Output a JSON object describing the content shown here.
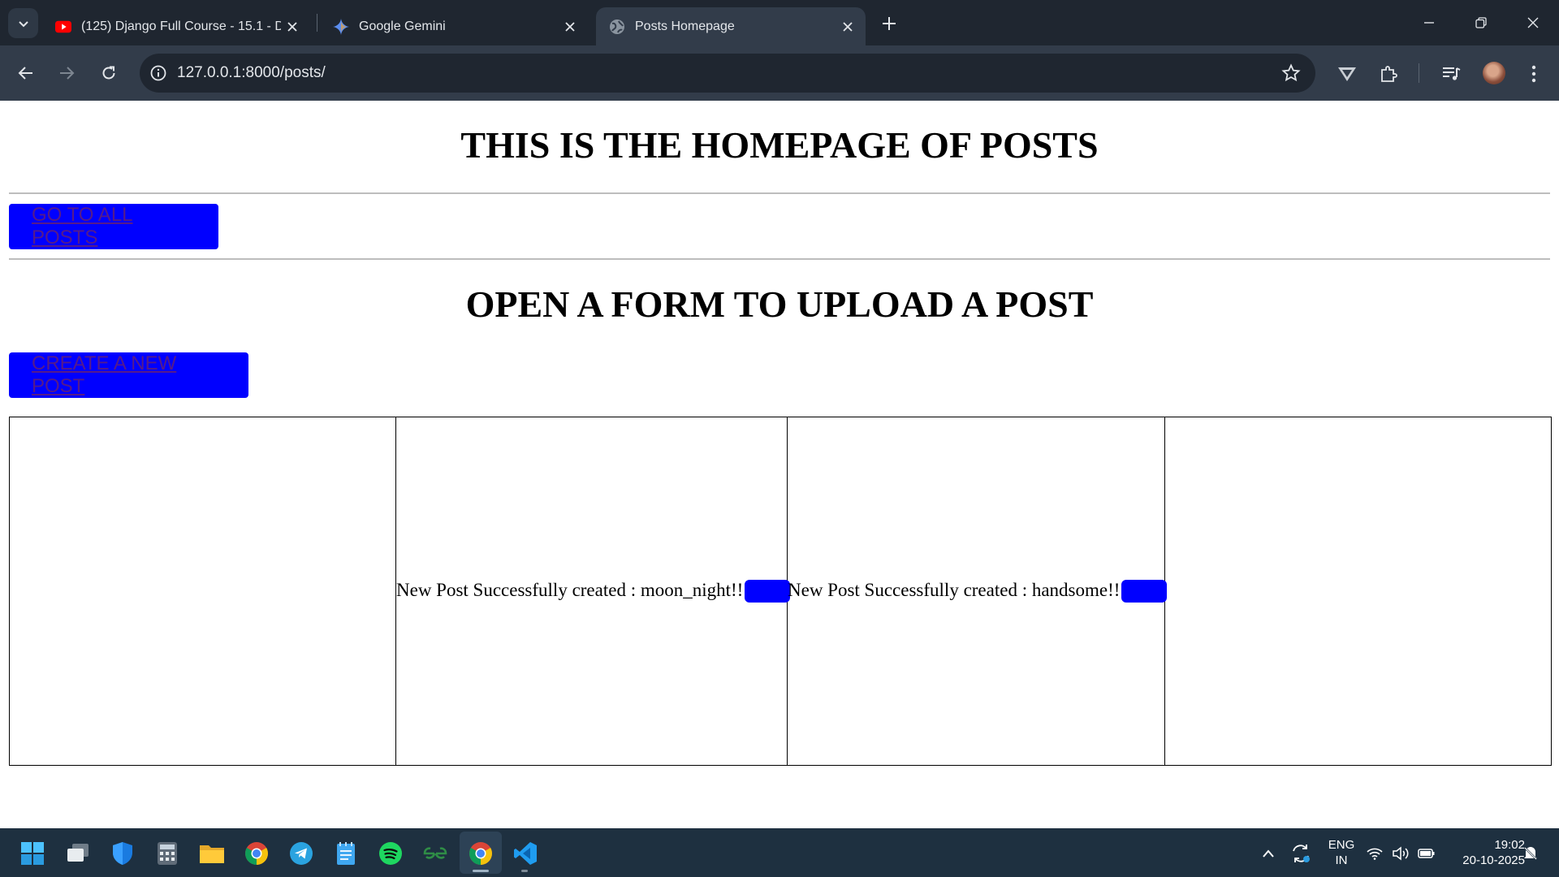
{
  "browser": {
    "tabs": [
      {
        "title": "(125) Django Full Course - 15.1 - D",
        "icon": "youtube-icon",
        "active": false
      },
      {
        "title": "Google Gemini",
        "icon": "gemini-icon",
        "active": false
      },
      {
        "title": "Posts Homepage",
        "icon": "globe-icon",
        "active": true
      }
    ],
    "url": "127.0.0.1:8000/posts/"
  },
  "page": {
    "heading": "THIS IS THE HOMEPAGE OF POSTS",
    "all_posts_link": "GO TO ALL POSTS",
    "form_heading": "OPEN A FORM TO UPLOAD A POST",
    "create_post_link": "CREATE A NEW POST",
    "table_cells": [
      "",
      "New Post Successfully created : moon_night!!",
      "New Post Successfully created : handsome!!",
      ""
    ],
    "accent_color": "#0000ff"
  },
  "taskbar": {
    "apps": [
      "windows-start",
      "task-view",
      "windows-security",
      "calculator",
      "file-explorer",
      "chrome",
      "telegram",
      "notepad",
      "spotify",
      "geeksforgeeks",
      "chrome-active",
      "vscode"
    ],
    "language": "ENG",
    "region": "IN",
    "time": "19:02",
    "date": "20-10-2025"
  }
}
